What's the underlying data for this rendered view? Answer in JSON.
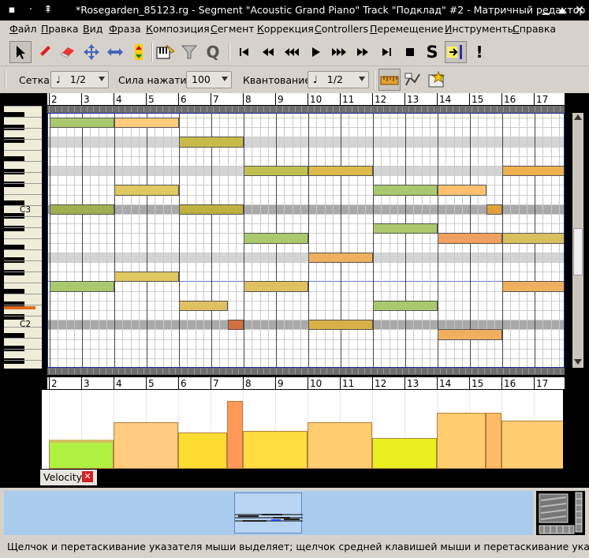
{
  "window": {
    "title": "*Rosegarden_85123.rg - Segment \"Acoustic Grand Piano\" Track \"Подклад\" #2 - Матричный редактор"
  },
  "menu": [
    {
      "label": "Файл",
      "u": "Ф",
      "rest": "айл"
    },
    {
      "label": "Правка",
      "u": "П",
      "rest": "равка"
    },
    {
      "label": "Вид",
      "u": "В",
      "rest": "ид"
    },
    {
      "label": "Фраза",
      "u": "Ф",
      "rest": "раза"
    },
    {
      "label": "Композиция",
      "u": "К",
      "rest": "омпозиция"
    },
    {
      "label": "Сегмент",
      "u": "С",
      "rest": "егмент"
    },
    {
      "label": "Коррекция",
      "u": "К",
      "rest": "оррекция"
    },
    {
      "label": "Controllers",
      "u": "C",
      "rest": "ontrollers"
    },
    {
      "label": "Перемещение",
      "u": "П",
      "rest": "еремещение"
    },
    {
      "label": "Инструменты",
      "u": "И",
      "rest": "нструменты"
    },
    {
      "label": "Справка",
      "u": "С",
      "rest": "правка"
    }
  ],
  "toolbar": {
    "tools": [
      "select-icon",
      "pencil-icon",
      "eraser-icon",
      "move-icon",
      "resize-icon",
      "velocity-icon"
    ],
    "edit": [
      "chord-icon",
      "filter-icon",
      "quantize-icon"
    ],
    "transport": [
      "rewind-start-icon",
      "rewind-icon",
      "fast-rewind-icon",
      "play-icon",
      "fast-forward-icon",
      "forward-icon",
      "forward-end-icon",
      "stop-icon",
      "solo-icon",
      "loop-icon",
      "panic-icon"
    ],
    "quantize_letter": "Q",
    "solo_letter": "S",
    "panic_letter": "!"
  },
  "options": {
    "grid_label": "Сетка:",
    "grid_value": "1/2",
    "velocity_label": "Сила нажатия:",
    "velocity_value": "100",
    "quantize_label": "Квантование:",
    "quantize_value": "1/2",
    "note_glyph": "♩"
  },
  "ruler": {
    "bars": [
      "2",
      "3",
      "4",
      "5",
      "6",
      "7",
      "8",
      "9",
      "10",
      "11",
      "12",
      "13",
      "14",
      "15",
      "16",
      "17"
    ]
  },
  "piano": {
    "labels": [
      "C3",
      "C2"
    ]
  },
  "notes": [
    {
      "bar": 2,
      "len": 2,
      "row": 0,
      "color": "#a9c96c"
    },
    {
      "bar": 4,
      "len": 2,
      "row": 0,
      "color": "#ffcc80"
    },
    {
      "bar": 6,
      "len": 2,
      "row": 2,
      "color": "#c8bb4a"
    },
    {
      "bar": 8,
      "len": 2,
      "row": 5,
      "color": "#c0c050"
    },
    {
      "bar": 10,
      "len": 2,
      "row": 5,
      "color": "#dcbb4c"
    },
    {
      "bar": 16,
      "len": 2,
      "row": 5,
      "color": "#f0b050"
    },
    {
      "bar": 4,
      "len": 2,
      "row": 7,
      "color": "#e0c860"
    },
    {
      "bar": 12,
      "len": 2,
      "row": 7,
      "color": "#a9c96c"
    },
    {
      "bar": 14,
      "len": 1.5,
      "row": 7,
      "color": "#ffc070"
    },
    {
      "bar": 2,
      "len": 2,
      "row": 9,
      "color": "#a0b050"
    },
    {
      "bar": 6,
      "len": 2,
      "row": 9,
      "color": "#c0b040"
    },
    {
      "bar": 15.5,
      "len": 0.5,
      "row": 9,
      "color": "#e0a040"
    },
    {
      "bar": 12,
      "len": 2,
      "row": 11,
      "color": "#a9c96c"
    },
    {
      "bar": 8,
      "len": 2,
      "row": 12,
      "color": "#a9c96c"
    },
    {
      "bar": 14,
      "len": 2,
      "row": 12,
      "color": "#f0a060"
    },
    {
      "bar": 16,
      "len": 2,
      "row": 12,
      "color": "#d8c060"
    },
    {
      "bar": 10,
      "len": 2,
      "row": 14,
      "color": "#f0b060"
    },
    {
      "bar": 4,
      "len": 2,
      "row": 16,
      "color": "#e0c860"
    },
    {
      "bar": 2,
      "len": 2,
      "row": 17,
      "color": "#a9c96c"
    },
    {
      "bar": 8,
      "len": 2,
      "row": 17,
      "color": "#e0c060"
    },
    {
      "bar": 16,
      "len": 2,
      "row": 17,
      "color": "#f0b060"
    },
    {
      "bar": 6,
      "len": 1.5,
      "row": 19,
      "color": "#e0c060"
    },
    {
      "bar": 12,
      "len": 2,
      "row": 19,
      "color": "#a9c96c"
    },
    {
      "bar": 7.5,
      "len": 0.5,
      "row": 21,
      "color": "#d47040"
    },
    {
      "bar": 10,
      "len": 2,
      "row": 21,
      "color": "#d8b048"
    },
    {
      "bar": 14,
      "len": 2,
      "row": 22,
      "color": "#f0b060"
    }
  ],
  "grid_rows": {
    "count": 26,
    "gray_light": [
      2,
      5,
      14,
      21
    ],
    "gray_dark": [
      9,
      21
    ],
    "blue_line_row": 17
  },
  "velocity": {
    "label": "Velocity",
    "bars": [
      {
        "bar": 2,
        "len": 2,
        "value": 37,
        "color": "#b0f040",
        "edge": "#d0c060"
      },
      {
        "bar": 4,
        "len": 2,
        "value": 59,
        "color": "#ffcc80"
      },
      {
        "bar": 6,
        "len": 1.5,
        "value": 46,
        "color": "#ffdd30"
      },
      {
        "bar": 7.5,
        "len": 0.5,
        "value": 86,
        "color": "#ff9955"
      },
      {
        "bar": 8,
        "len": 2,
        "value": 48,
        "color": "#ffdd40"
      },
      {
        "bar": 10,
        "len": 2,
        "value": 59,
        "color": "#ffcc70"
      },
      {
        "bar": 12,
        "len": 2,
        "value": 39,
        "color": "#e8f020"
      },
      {
        "bar": 14,
        "len": 1.5,
        "value": 71,
        "color": "#ffcc70"
      },
      {
        "bar": 15.5,
        "len": 0.5,
        "value": 71,
        "color": "#ffbb66"
      },
      {
        "bar": 16,
        "len": 2,
        "value": 61,
        "color": "#ffcc70"
      }
    ]
  },
  "status": "Щелчок и перетаскивание указателя мыши выделяет; щелчок средней клавишей мыши и перетаскивание указателя рисует"
}
